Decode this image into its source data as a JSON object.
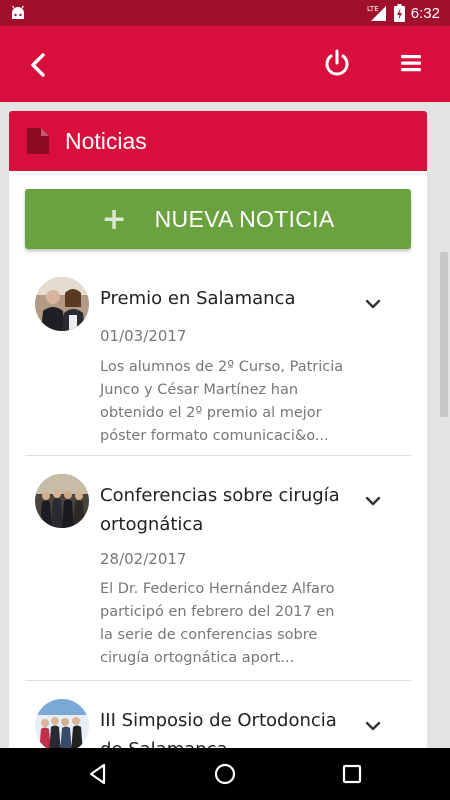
{
  "status_bar": {
    "time": "6:32",
    "network": "LTE",
    "icons": [
      "android-icon",
      "signal-icon",
      "battery-charging-icon"
    ]
  },
  "app_bar": {
    "icons": [
      "back-icon",
      "power-icon",
      "menu-icon"
    ],
    "color": "#d80f3c"
  },
  "card": {
    "title": "Noticias",
    "header_icon": "document-icon"
  },
  "new_news_button": {
    "icon": "+",
    "label": "NUEVA NOTICIA",
    "color": "#6aa23f"
  },
  "news": [
    {
      "title": "Premio en Salamanca",
      "date": "01/03/2017",
      "summary": "Los alumnos de 2º Curso, Patricia Junco y César Martínez han obtenido el 2º premio al mejor póster formato comunicaci&o...",
      "icon": "chevron-down-icon"
    },
    {
      "title": "Conferencias sobre cirugía ortognática",
      "date": "28/02/2017",
      "summary": "El Dr. Federico Hernández Alfaro participó en febrero del 2017 en la serie de conferencias sobre cirugía ortognática aport...",
      "icon": "chevron-down-icon"
    },
    {
      "title": "III Simposio de Ortodoncia de Salamanca",
      "date": "",
      "summary": "",
      "icon": "chevron-down-icon"
    }
  ],
  "nav_bar": {
    "icons": [
      "back-triangle-icon",
      "home-circle-icon",
      "recents-square-icon"
    ]
  }
}
